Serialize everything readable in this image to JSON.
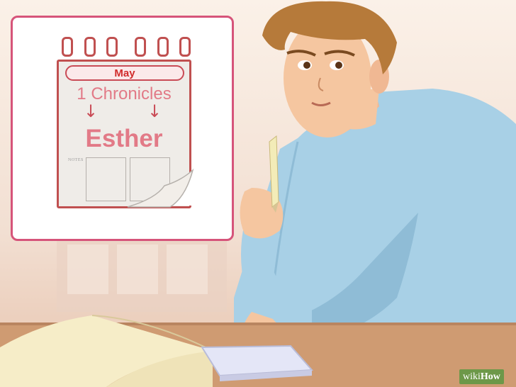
{
  "calendar": {
    "month": "May",
    "reading_start": "1 Chronicles",
    "arrow_glyph": "↓",
    "reading_end": "Esther",
    "notes_label": "NOTES"
  },
  "watermark": {
    "prefix": "wiki",
    "suffix": "How"
  },
  "colors": {
    "frame": "#d6547a",
    "calendar_border": "#c05050",
    "month_text": "#d12c2c",
    "reading_text": "#e27a87",
    "shirt": "#a8d0e6",
    "skin": "#f5c6a0",
    "hair": "#b67a3a",
    "table": "#cf9b72"
  },
  "icons": [
    "pencil-icon",
    "open-book-icon",
    "notepad-icon",
    "calendar-icon"
  ]
}
